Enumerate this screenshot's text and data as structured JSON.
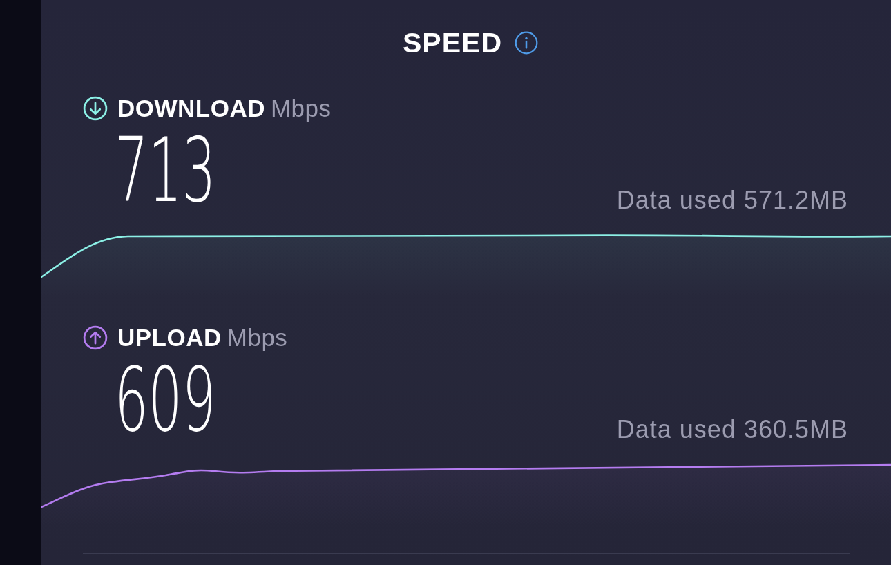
{
  "title": "SPEED",
  "metrics": [
    {
      "kind": "download",
      "label": "DOWNLOAD",
      "unit": "Mbps",
      "value": "713",
      "data_used": "Data used 571.2MB",
      "color": "#8cf0e6"
    },
    {
      "kind": "upload",
      "label": "UPLOAD",
      "unit": "Mbps",
      "value": "609",
      "data_used": "Data used 360.5MB",
      "color": "#b47cf0"
    }
  ]
}
